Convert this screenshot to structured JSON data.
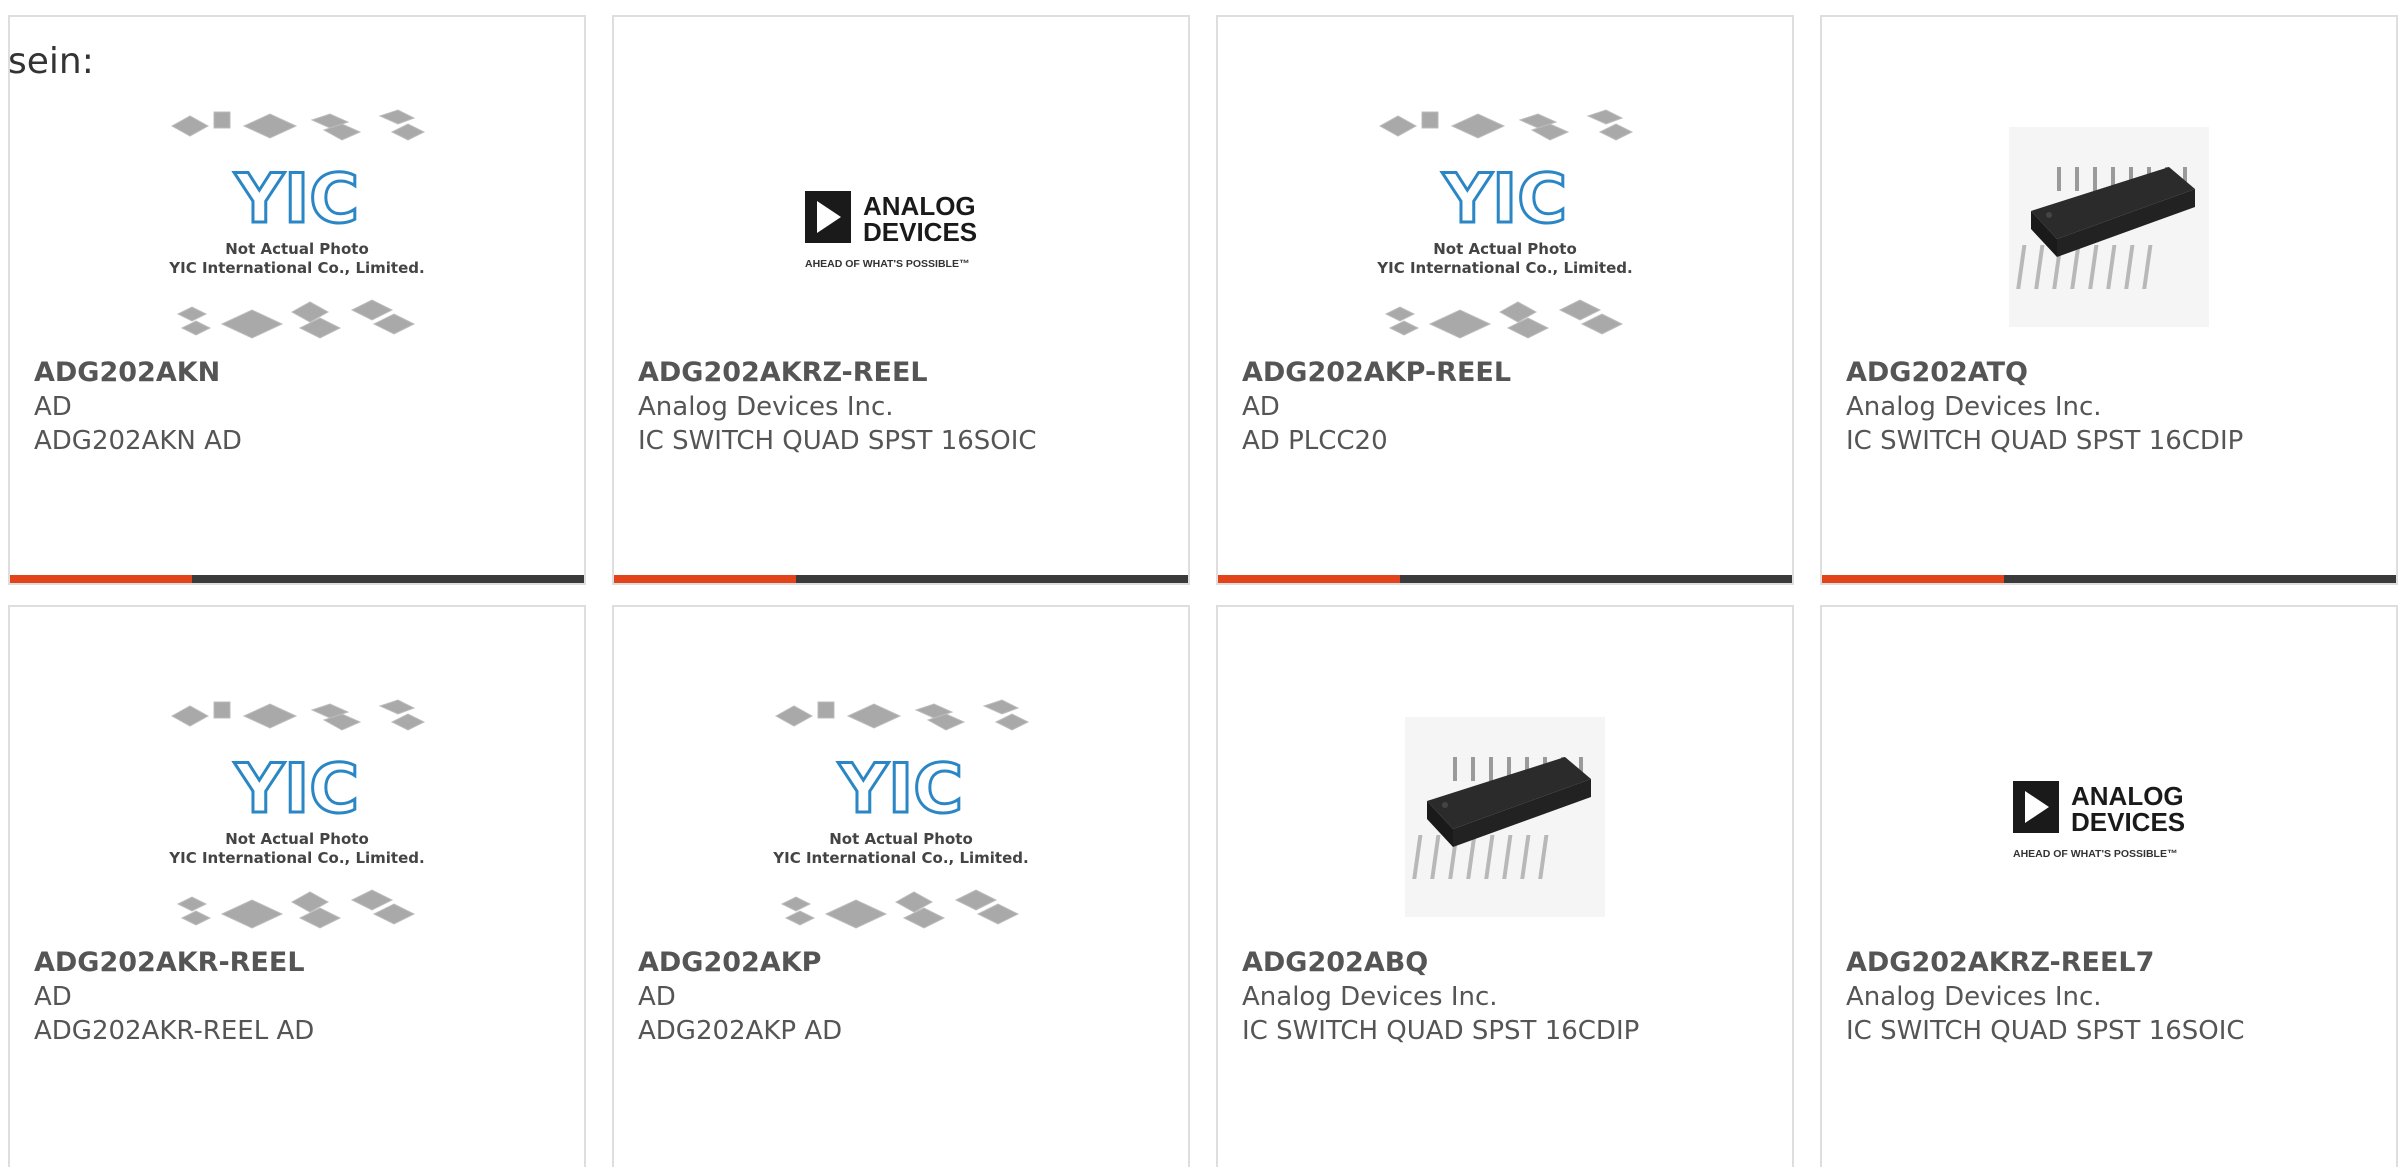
{
  "intro_text": "sein:",
  "image_texts": {
    "yic_caption_1": "Not Actual Photo",
    "yic_caption_2": "YIC International Co., Limited.",
    "yic_logo": "YIC",
    "adi_logo_line1": "ANALOG",
    "adi_logo_line2": "DEVICES",
    "adi_tagline": "AHEAD OF WHAT'S POSSIBLE™"
  },
  "colors": {
    "accent": "#e2431b",
    "bar_dark": "#3a3a3a",
    "text": "#555555",
    "card_border": "#dedede",
    "yic_blue": "#2a86c4"
  },
  "products": [
    {
      "part": "ADG202AKN",
      "maker": "AD",
      "desc": "ADG202AKN AD",
      "image": "yic-placeholder-icon"
    },
    {
      "part": "ADG202AKRZ-REEL",
      "maker": "Analog Devices Inc.",
      "desc": "IC SWITCH QUAD SPST 16SOIC",
      "image": "analog-devices-logo"
    },
    {
      "part": "ADG202AKP-REEL",
      "maker": "AD",
      "desc": "AD PLCC20",
      "image": "yic-placeholder-icon"
    },
    {
      "part": "ADG202ATQ",
      "maker": "Analog Devices Inc.",
      "desc": "IC SWITCH QUAD SPST 16CDIP",
      "image": "dip-chip-photo"
    },
    {
      "part": "ADG202AKR-REEL",
      "maker": "AD",
      "desc": "ADG202AKR-REEL AD",
      "image": "yic-placeholder-icon"
    },
    {
      "part": "ADG202AKP",
      "maker": "AD",
      "desc": "ADG202AKP AD",
      "image": "yic-placeholder-icon"
    },
    {
      "part": "ADG202ABQ",
      "maker": "Analog Devices Inc.",
      "desc": "IC SWITCH QUAD SPST 16CDIP",
      "image": "dip-chip-photo"
    },
    {
      "part": "ADG202AKRZ-REEL7",
      "maker": "Analog Devices Inc.",
      "desc": "IC SWITCH QUAD SPST 16SOIC",
      "image": "analog-devices-logo"
    }
  ]
}
